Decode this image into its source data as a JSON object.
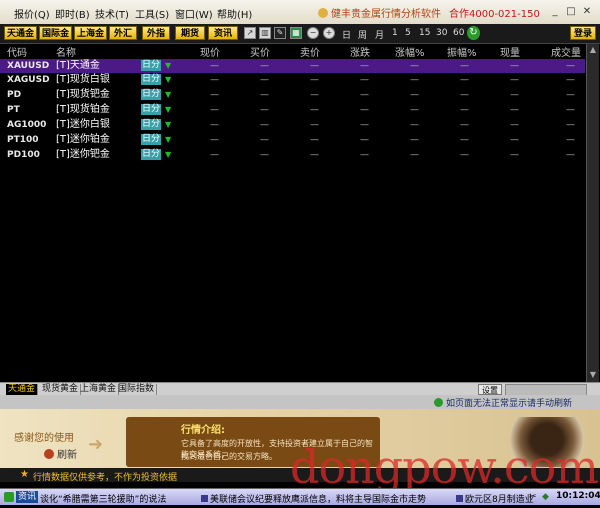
{
  "menubar": {
    "items": [
      "报价(Q)",
      "即时(B)",
      "技术(T)",
      "工具(S)",
      "窗口(W)",
      "帮助(H)"
    ],
    "brand": "健丰贵金属行情分析软件",
    "phone": "合作4000-021-150"
  },
  "toolbar": {
    "buttons": [
      "天通金",
      "国际金",
      "上海金",
      "外汇",
      "外指",
      "期货",
      "资讯"
    ],
    "periods": [
      "日",
      "周",
      "月",
      "1",
      "5",
      "15",
      "30",
      "60"
    ],
    "login": "登录"
  },
  "table": {
    "columns": [
      "代码",
      "名称",
      "现价",
      "买价",
      "卖价",
      "涨跌",
      "涨幅%",
      "振幅%",
      "现量",
      "成交量"
    ],
    "rows": [
      {
        "code": "XAUUSD",
        "name": "[T]天通金",
        "period": "日分",
        "price": "—",
        "bid": "—",
        "ask": "—",
        "chg": "—",
        "pct": "—",
        "amp": "—",
        "vol": "—",
        "total": "—"
      },
      {
        "code": "XAGUSD",
        "name": "[T]现货白银",
        "period": "日分",
        "price": "—",
        "bid": "—",
        "ask": "—",
        "chg": "—",
        "pct": "—",
        "amp": "—",
        "vol": "—",
        "total": "—"
      },
      {
        "code": "PD",
        "name": "[T]现货钯金",
        "period": "日分",
        "price": "—",
        "bid": "—",
        "ask": "—",
        "chg": "—",
        "pct": "—",
        "amp": "—",
        "vol": "—",
        "total": "—"
      },
      {
        "code": "PT",
        "name": "[T]现货铂金",
        "period": "日分",
        "price": "—",
        "bid": "—",
        "ask": "—",
        "chg": "—",
        "pct": "—",
        "amp": "—",
        "vol": "—",
        "total": "—"
      },
      {
        "code": "AG1000",
        "name": "[T]迷你白银",
        "period": "日分",
        "price": "—",
        "bid": "—",
        "ask": "—",
        "chg": "—",
        "pct": "—",
        "amp": "—",
        "vol": "—",
        "total": "—"
      },
      {
        "code": "PT100",
        "name": "[T]迷你铂金",
        "period": "日分",
        "price": "—",
        "bid": "—",
        "ask": "—",
        "chg": "—",
        "pct": "—",
        "amp": "—",
        "vol": "—",
        "total": "—"
      },
      {
        "code": "PD100",
        "name": "[T]迷你钯金",
        "period": "日分",
        "price": "—",
        "bid": "—",
        "ask": "—",
        "chg": "—",
        "pct": "—",
        "amp": "—",
        "vol": "—",
        "total": "—"
      }
    ]
  },
  "bottom_tabs": [
    "天通金",
    "现货黄金",
    "上海黄金",
    "国际指数"
  ],
  "settings_label": "设置",
  "info_message": "如页面无法正常显示请手动刷新",
  "ad": {
    "thanks": "感谢您的使用",
    "refresh": "刷新",
    "title": "行情介绍:",
    "line1": "它具备了高度的开放性，支持投资者建立属于自己的智能交易系统，",
    "line2": "找到适合自己的交易方略。"
  },
  "tip": "行情数据仅供参考，不作为投资依据",
  "ticker": {
    "label": "资讯",
    "items": [
      "谈化“希腊需第三轮援助”的说法",
      "美联储会议纪要释放鹰派信息，料将主导国际金市走势",
      "欧元区8月制造业"
    ],
    "clock": "10:12:04"
  },
  "watermark": "dongpow.com",
  "colors": {
    "selected_row": "#4b1a86",
    "accent": "#e8b400",
    "up_arrow": "#18c020"
  }
}
